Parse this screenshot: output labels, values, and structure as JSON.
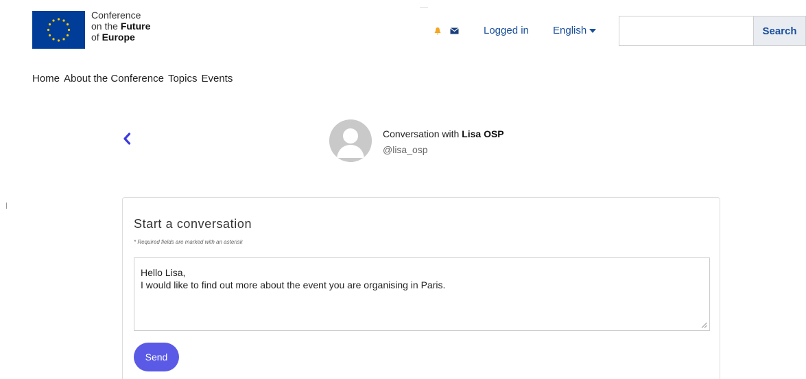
{
  "header": {
    "logo_lines": [
      "Conference",
      "on the ",
      "Future",
      "of ",
      "Europe"
    ],
    "logo_line1": "Conference",
    "logo_line2_prefix": "on the ",
    "logo_line2_bold": "Future",
    "logo_line3_prefix": "of ",
    "logo_line3_bold": "Europe",
    "logged_in_label": "Logged in",
    "language": "English",
    "search_placeholder": "",
    "search_value": "",
    "search_button": "Search",
    "icons": {
      "notifications": "bell-icon",
      "messages": "envelope-icon",
      "language_caret": "caret-down-icon"
    },
    "colors": {
      "flag_blue": "#003d99",
      "star_yellow": "#ffcc00",
      "link_blue": "#1a4f9c",
      "bell_orange": "#f5a623"
    }
  },
  "nav": {
    "items": [
      "Home",
      "About the Conference",
      "Topics",
      "Events"
    ]
  },
  "conversation": {
    "title_prefix": "Conversation with ",
    "title_name": "Lisa OSP",
    "handle": "@lisa_osp",
    "back_icon": "chevron-left-icon"
  },
  "form": {
    "title": "Start a conversation",
    "required_note": "* Required fields are marked with an asterisk",
    "message_lines": [
      "Hello Lisa,",
      "I would like to find out more about the event you are organising in Paris."
    ],
    "send_label": "Send",
    "colors": {
      "send_button": "#5a5ae6"
    }
  }
}
